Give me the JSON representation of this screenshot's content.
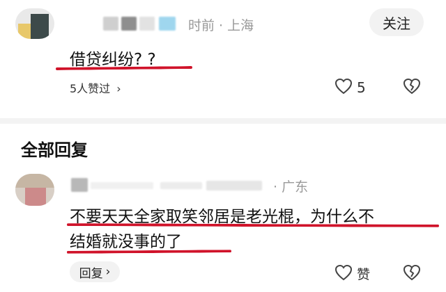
{
  "comment": {
    "meta": "时前 · 上海",
    "follow_label": "关注",
    "text": "借贷纠纷? ?",
    "likers_text": "5人赞过",
    "likers_chevron": "›",
    "like_count": "5"
  },
  "section_title": "全部回复",
  "reply": {
    "meta": "· 广东",
    "text_line1": "不要天天全家取笑邻居是老光棍，为什么不",
    "text_line2": "结婚就没事的了",
    "reply_label": "回复",
    "reply_chevron": "›",
    "like_label": "赞"
  },
  "colors": {
    "underline": "#d0132a",
    "meta_text": "#999999",
    "button_bg": "#f2f2f2"
  },
  "icons": [
    "heart-outline-icon",
    "broken-heart-icon",
    "chevron-right-icon"
  ]
}
